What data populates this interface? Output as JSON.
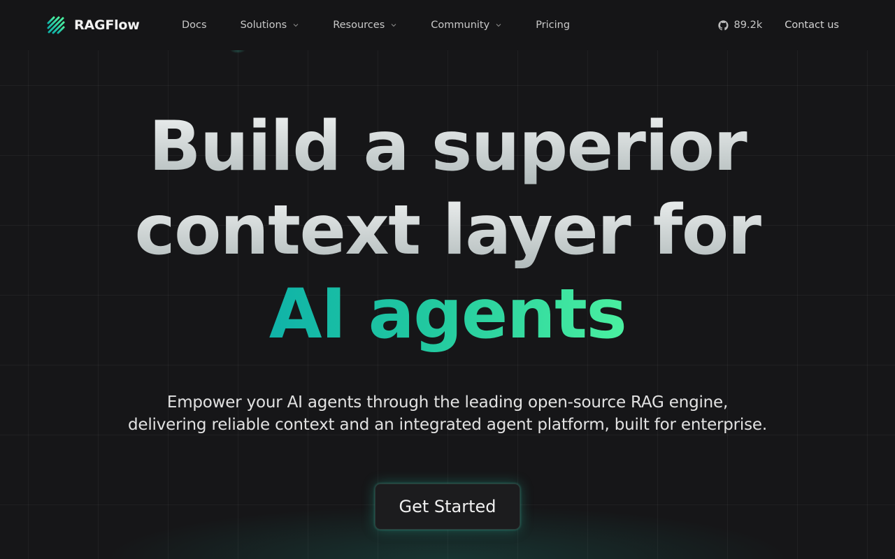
{
  "brand": {
    "name": "RAGFlow",
    "logo_icon": "stripes-logo-icon",
    "accent_start": "#10b3a8",
    "accent_end": "#4af0a0"
  },
  "nav": {
    "items": [
      {
        "label": "Docs",
        "has_dropdown": false
      },
      {
        "label": "Solutions",
        "has_dropdown": true
      },
      {
        "label": "Resources",
        "has_dropdown": true
      },
      {
        "label": "Community",
        "has_dropdown": true
      },
      {
        "label": "Pricing",
        "has_dropdown": false
      }
    ],
    "github_stars": "89.2k",
    "contact_label": "Contact us"
  },
  "hero": {
    "title_line1": "Build a superior",
    "title_line2": "context layer for",
    "title_accent": "AI agents",
    "subtitle_line1": "Empower your AI agents through the leading open-source RAG engine,",
    "subtitle_line2": "delivering reliable context and an integrated agent platform, built for enterprise.",
    "cta_label": "Get Started"
  }
}
